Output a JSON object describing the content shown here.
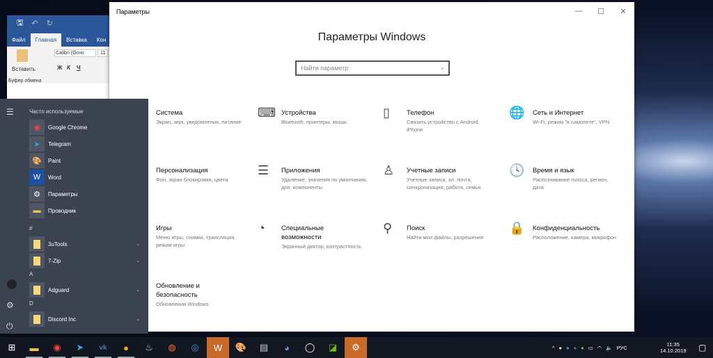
{
  "word": {
    "tabs": [
      "Файл",
      "Главная",
      "Вставка",
      "Кон"
    ],
    "font": "Calibri (Осно",
    "size": "11",
    "paste": "Вставить",
    "clipboard": "Буфер обмена",
    "format": [
      "Ж",
      "К",
      "Ч"
    ]
  },
  "settings": {
    "window_title": "Параметры",
    "heading": "Параметры Windows",
    "search_placeholder": "Найти параметр",
    "tiles": [
      {
        "title": "Система",
        "desc": "Экран, звук, уведомления, питание",
        "icon": "monitor-icon"
      },
      {
        "title": "Устройства",
        "desc": "Bluetooth, принтеры, мышь",
        "icon": "devices-icon"
      },
      {
        "title": "Телефон",
        "desc": "Связать устройство с Android, iPhone",
        "icon": "phone-icon"
      },
      {
        "title": "Сеть и Интернет",
        "desc": "Wi-Fi, режим \"в самолете\", VPN",
        "icon": "globe-icon"
      },
      {
        "title": "Персонализация",
        "desc": "Фон, экран блокировки, цвета",
        "icon": "brush-icon"
      },
      {
        "title": "Приложения",
        "desc": "Удаление, значения по умолчанию, доп. компоненты",
        "icon": "apps-list-icon"
      },
      {
        "title": "Учетные записи",
        "desc": "Учетные записи, эл. почта, синхронизация, работа, семья",
        "icon": "person-icon"
      },
      {
        "title": "Время и язык",
        "desc": "Распознавание голоса, регион, дата",
        "icon": "time-language-icon"
      },
      {
        "title": "Игры",
        "desc": "Меню игры, снимки, трансляция, режим игры",
        "icon": "xbox-icon"
      },
      {
        "title": "Специальные возможности",
        "desc": "Экранный диктор, контрастность",
        "icon": "ease-of-access-icon"
      },
      {
        "title": "Поиск",
        "desc": "Найти мои файлы, разрешения",
        "icon": "search-icon"
      },
      {
        "title": "Конфиденциальность",
        "desc": "Расположение, камера, микрофон",
        "icon": "lock-icon"
      },
      {
        "title": "Обновление и безопасность",
        "desc": "Обновления Windows",
        "icon": "update-icon"
      }
    ]
  },
  "start": {
    "frequent_header": "Часто используемые",
    "frequent": [
      {
        "label": "Google Chrome",
        "icon": "chrome-icon"
      },
      {
        "label": "Telegram",
        "icon": "telegram-icon"
      },
      {
        "label": "Paint",
        "icon": "paint-icon"
      },
      {
        "label": "Word",
        "icon": "word-icon"
      },
      {
        "label": "Параметры",
        "icon": "gear-icon"
      },
      {
        "label": "Проводник",
        "icon": "explorer-icon"
      }
    ],
    "groups": [
      {
        "letter": "#",
        "items": [
          "3uTools",
          "7-Zip"
        ]
      },
      {
        "letter": "A",
        "items": [
          "Adguard"
        ]
      },
      {
        "letter": "D",
        "items": [
          "Discord Inc"
        ]
      }
    ]
  },
  "taskbar": {
    "apps": [
      "explorer",
      "chrome",
      "telegram",
      "vk",
      "yandex-browser",
      "steam",
      "origin",
      "uplay",
      "word",
      "paint",
      "sticky",
      "discord",
      "oculus",
      "nvidia",
      "settings"
    ],
    "lang": "РУС",
    "time": "11:35",
    "date": "14.10.2019",
    "accent": "#c86b2a"
  }
}
